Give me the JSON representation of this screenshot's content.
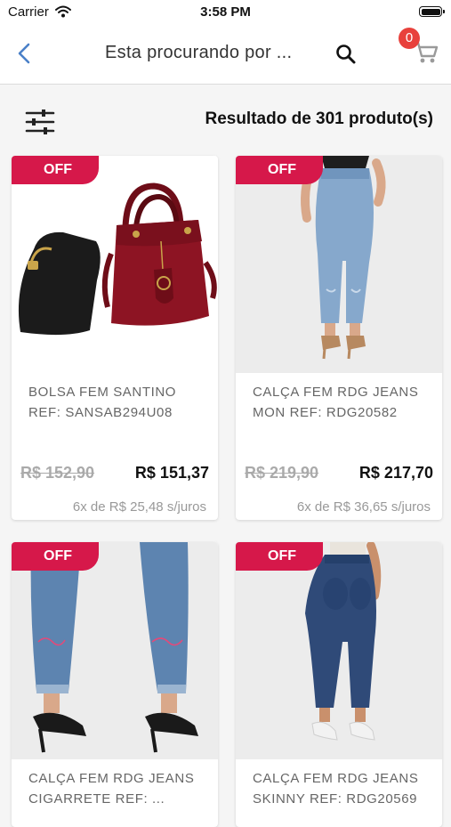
{
  "status_bar": {
    "carrier": "Carrier",
    "time": "3:58 PM"
  },
  "nav": {
    "title": "Esta procurando por ...",
    "cart_badge": "0",
    "icons": [
      "chevron-left-icon",
      "search-icon",
      "cart-icon"
    ]
  },
  "results": {
    "count_text": "Resultado de 301 produto(s)",
    "icon": "filter-sliders-icon"
  },
  "colors": {
    "accent": "#d6184a",
    "badge": "#e8413c",
    "back": "#4a80c8"
  },
  "products": [
    {
      "badge": "OFF",
      "name": "BOLSA FEM SANTINO REF: SANSAB294U08",
      "old_price": "R$ 152,90",
      "price": "R$ 151,37",
      "installments": "6x de R$ 25,48 s/juros",
      "image": "handbag-set"
    },
    {
      "badge": "OFF",
      "name": "CALÇA FEM RDG JEANS MON REF: RDG20582",
      "old_price": "R$ 219,90",
      "price": "R$ 217,70",
      "installments": "6x de R$ 36,65 s/juros",
      "image": "light-wash-mom-jeans"
    },
    {
      "badge": "OFF",
      "name": "CALÇA FEM RDG JEANS CIGARRETE REF: ...",
      "image": "cigarette-jeans-heels"
    },
    {
      "badge": "OFF",
      "name": "CALÇA FEM RDG JEANS SKINNY REF: RDG20569",
      "image": "dark-skinny-jeans"
    }
  ]
}
